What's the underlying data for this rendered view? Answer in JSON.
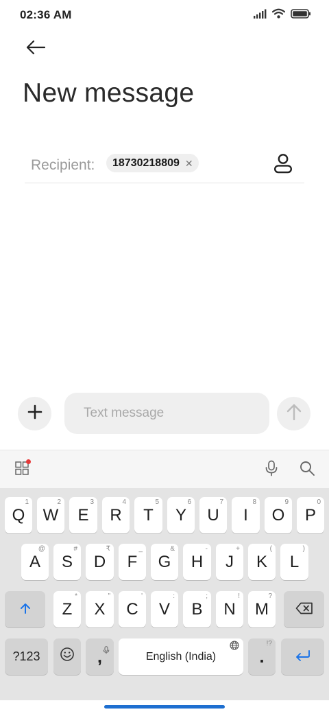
{
  "status_bar": {
    "time": "02:36 AM",
    "icons": [
      "cellular-signal-icon",
      "wifi-icon",
      "battery-icon"
    ]
  },
  "header": {
    "back_icon": "arrow-left-icon",
    "title": "New message"
  },
  "recipient": {
    "label": "Recipient:",
    "chips": [
      {
        "value": "18730218809",
        "remove_icon": "close-icon"
      }
    ],
    "contact_icon": "person-icon"
  },
  "compose": {
    "add_icon": "plus-icon",
    "placeholder": "Text message",
    "value": "",
    "send_icon": "arrow-up-icon"
  },
  "keyboard_toolbar": {
    "apps_icon": "grid-icon",
    "mic_icon": "microphone-icon",
    "search_icon": "search-icon",
    "notification_color": "#e63a3a"
  },
  "keyboard": {
    "row1": [
      {
        "label": "Q",
        "hint": "1"
      },
      {
        "label": "W",
        "hint": "2"
      },
      {
        "label": "E",
        "hint": "3"
      },
      {
        "label": "R",
        "hint": "4"
      },
      {
        "label": "T",
        "hint": "5"
      },
      {
        "label": "Y",
        "hint": "6"
      },
      {
        "label": "U",
        "hint": "7"
      },
      {
        "label": "I",
        "hint": "8"
      },
      {
        "label": "O",
        "hint": "9"
      },
      {
        "label": "P",
        "hint": "0"
      }
    ],
    "row2": [
      {
        "label": "A",
        "hint": "@"
      },
      {
        "label": "S",
        "hint": "#"
      },
      {
        "label": "D",
        "hint": "₹"
      },
      {
        "label": "F",
        "hint": "_"
      },
      {
        "label": "G",
        "hint": "&"
      },
      {
        "label": "H",
        "hint": "-"
      },
      {
        "label": "J",
        "hint": "+"
      },
      {
        "label": "K",
        "hint": "("
      },
      {
        "label": "L",
        "hint": ")"
      }
    ],
    "row3": [
      {
        "label": "Z",
        "hint": "*"
      },
      {
        "label": "X",
        "hint": "\""
      },
      {
        "label": "C",
        "hint": "'"
      },
      {
        "label": "V",
        "hint": ":"
      },
      {
        "label": "B",
        "hint": ";"
      },
      {
        "label": "N",
        "hint": "!"
      },
      {
        "label": "M",
        "hint": "?"
      }
    ],
    "shift_icon": "shift-arrow-icon",
    "backspace_icon": "backspace-icon",
    "symbols_label": "?123",
    "emoji_icon": "emoji-icon",
    "comma_label": ",",
    "comma_hint_icon": "microphone-icon",
    "space_label": "English (India)",
    "space_hint_icon": "globe-icon",
    "period_label": ".",
    "period_hint": "!?",
    "enter_icon": "enter-icon",
    "accent_color": "#1a73e8"
  },
  "nav": {
    "home_indicator_color": "#1e6fd0"
  }
}
